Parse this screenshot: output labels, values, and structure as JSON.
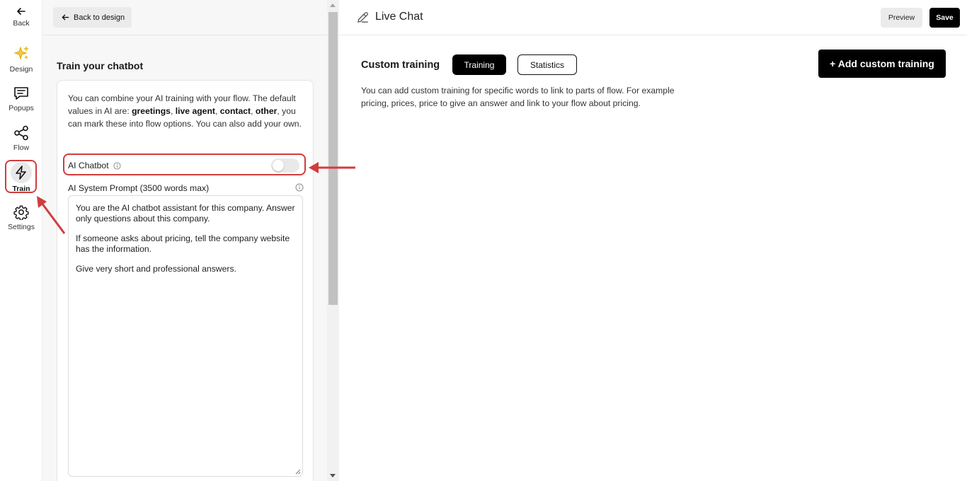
{
  "rail": {
    "back_label": "Back",
    "items": [
      {
        "label": "Design",
        "icon": "sparkles-icon"
      },
      {
        "label": "Popups",
        "icon": "message-icon"
      },
      {
        "label": "Flow",
        "icon": "share-icon"
      },
      {
        "label": "Train",
        "icon": "lightning-icon"
      },
      {
        "label": "Settings",
        "icon": "gear-icon"
      }
    ],
    "active": "Train"
  },
  "panel": {
    "back_button_label": "Back to design",
    "heading": "Train your chatbot",
    "description": {
      "part1": "You can combine your AI training with your flow. The default values in AI are: ",
      "greetings": "greetings",
      "sep1": ", ",
      "live_agent": "live agent",
      "sep2": ", ",
      "contact": "contact",
      "sep3": ", ",
      "other": "other",
      "part2": ", you can mark these into flow options. You can also add your own."
    },
    "ai_chatbot_label": "AI Chatbot",
    "ai_chatbot_enabled": false,
    "prompt_label": "AI System Prompt (3500 words max)",
    "prompt_lines": [
      "You are the AI chatbot assistant for this company. Answer only questions about this company.",
      "If someone asks about pricing, tell the company website has the information.",
      "Give very short and professional answers."
    ]
  },
  "main": {
    "title": "Live Chat",
    "preview_label": "Preview",
    "save_label": "Save",
    "section_title": "Custom training",
    "tabs": [
      {
        "label": "Training",
        "active": true
      },
      {
        "label": "Statistics",
        "active": false
      }
    ],
    "add_button_label": "+ Add custom training",
    "description": "You can add custom training for specific words to link to parts of flow. For example pricing, prices, price to give an answer and link to your flow about pricing."
  },
  "colors": {
    "accent": "#000000",
    "annotation": "#d23c3c",
    "sparkle": "#f5b800"
  }
}
